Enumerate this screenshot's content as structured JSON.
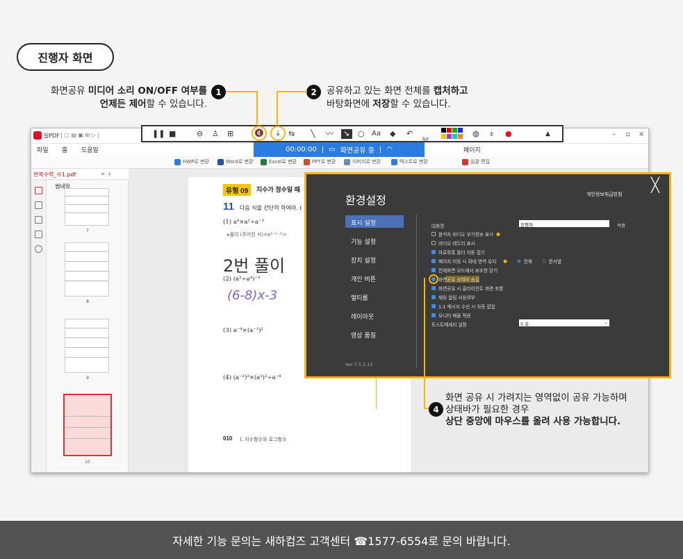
{
  "badge": "진행자 화면",
  "callout1": {
    "num": "1",
    "line1_a": "화면공유 ",
    "line1_b": "미디어 소리 ON/OFF 여부를",
    "line2_b": "언제든 제어",
    "line2_c": "할 수 있습니다."
  },
  "callout2": {
    "num": "2",
    "line1_a": "공유하고 있는 화면 전체를 ",
    "line1_b": "캡처하고",
    "line2_a": "바탕화면에 ",
    "line2_b": "저장",
    "line2_c": "할 수 있습니다."
  },
  "callout4": {
    "num": "4",
    "line1": "화면 공유 시 가려지는 영역없이 공유 가능하며",
    "line2": "상태바가 필요한 경우",
    "line3": "상단 중앙에 마우스를 올려 사용 가능합니다."
  },
  "app": {
    "title": "일PDF",
    "menu": [
      "파일",
      "홈",
      "도움말"
    ],
    "ribbon": [
      "HWP로 변환",
      "Word로 변환",
      "Excel로 변환",
      "PPT로 변환",
      "이미지로 변환",
      "텍스트로 변환",
      "일괄 편집"
    ],
    "page_label": "페이지",
    "file_tab": "반복수학_수1.pdf",
    "thumb_header": "썸네일",
    "thumb_numbers": [
      "7",
      "8",
      "9",
      "10"
    ]
  },
  "document": {
    "type_badge": "유형 09",
    "type_title": "지수가 정수일 때",
    "problem_num": "11",
    "problem_text": "다음 식을 간단히 하여라. (",
    "item1": "(1) a⁴×a²÷a⁻³",
    "solution": "▸풀이  (주어진 식)=a⁴⁺²⁻³⁾=",
    "item2": "(2) (a²÷a⁴)⁻³",
    "item3": "(3) a⁻⁴×(a⁻¹)²",
    "item4": "(4) (a⁻²)³×(a³)²÷a⁻⁴",
    "handwriting_title": "2번 풀이",
    "handwriting_math": "(6-8)x-3",
    "footer_page": "010",
    "footer_section": "I. 지수함수와 로그함수"
  },
  "toolbar": {
    "pen_size": "3pt",
    "text_tool": "Aa"
  },
  "timer": {
    "time": "00:00:00",
    "status": "화면공유 중"
  },
  "settings": {
    "title": "환경설정",
    "privacy_link": "개인정보취급방침",
    "menu": [
      "표시 설정",
      "기능 설정",
      "장치 설정",
      "개인 버튼",
      "멀티룸",
      "레이아웃",
      "영상 품질"
    ],
    "nickname_label": "대화명",
    "nickname_value": "진행자",
    "apply": "적용",
    "options": [
      {
        "label": "참석자 비디오 부가정보 표시",
        "checked": false
      },
      {
        "label": "비디오 테두리 표시",
        "checked": false
      },
      {
        "label": "자료목록 폴더 자동 접기",
        "checked": true
      },
      {
        "label": "페이지 이동 시 확대 영역 유지",
        "checked": true
      },
      {
        "label": "전체화면 모드에서 보조창 닫기",
        "checked": true
      },
      {
        "label": "화면공유 상태바 숨김",
        "checked": true
      },
      {
        "label": "화면공유 시 클라이언트 화면 포함",
        "checked": true
      },
      {
        "label": "채팅 알림 사용여부",
        "checked": true
      },
      {
        "label": "1:1 메시지 수신 시 자동 팝업",
        "checked": true
      },
      {
        "label": "모니터 배율 적용",
        "checked": true
      }
    ],
    "radio_all": "전체",
    "radio_doc": "문서별",
    "toast_label": "토스트메세지 설정",
    "toast_value": "5 초",
    "version": "Ver 7.5.1.15"
  },
  "footer": "자세한 기능 문의는 새하컴즈 고객센터 ☎1577-6554로 문의 바랍니다.",
  "colors": {
    "accent": "#f6b500",
    "blue": "#2a7ce0",
    "dialog": "#3b3b3b",
    "footer": "#525252"
  }
}
